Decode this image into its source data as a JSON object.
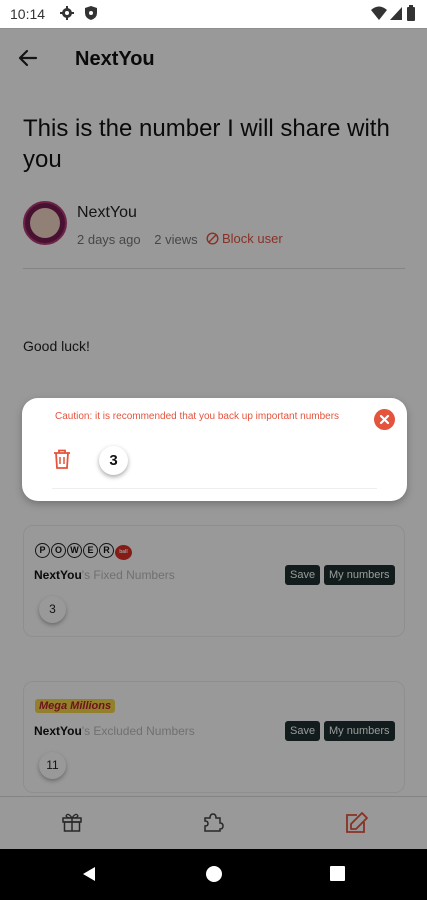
{
  "status_bar": {
    "time": "10:14"
  },
  "app_bar": {
    "title": "NextYou"
  },
  "post": {
    "title": "This is the number I will share with you",
    "author": "NextYou",
    "posted": "2 days ago",
    "views": "2 views",
    "block_label": "Block user",
    "body": "Good luck!"
  },
  "cards": [
    {
      "logo_letters": [
        "P",
        "O",
        "W",
        "E",
        "R"
      ],
      "logo_ball": "ball",
      "owner": "NextYou",
      "suffix": "'s Fixed Numbers",
      "save_label": "Save",
      "my_numbers_label": "My numbers",
      "numbers": [
        "3"
      ]
    },
    {
      "logo_text": "Mega Millions",
      "owner": "NextYou",
      "suffix": "'s Excluded Numbers",
      "save_label": "Save",
      "my_numbers_label": "My numbers",
      "numbers": [
        "11"
      ]
    }
  ],
  "popup": {
    "caution": "Caution: it is recommended that you back up important numbers",
    "number": "3"
  },
  "bottom_nav": {
    "items": [
      "gift-icon",
      "puzzle-icon",
      "edit-icon"
    ],
    "active_color": "#e5533d"
  },
  "colors": {
    "accent": "#e5533d",
    "dark_button": "#1f2f2f"
  }
}
